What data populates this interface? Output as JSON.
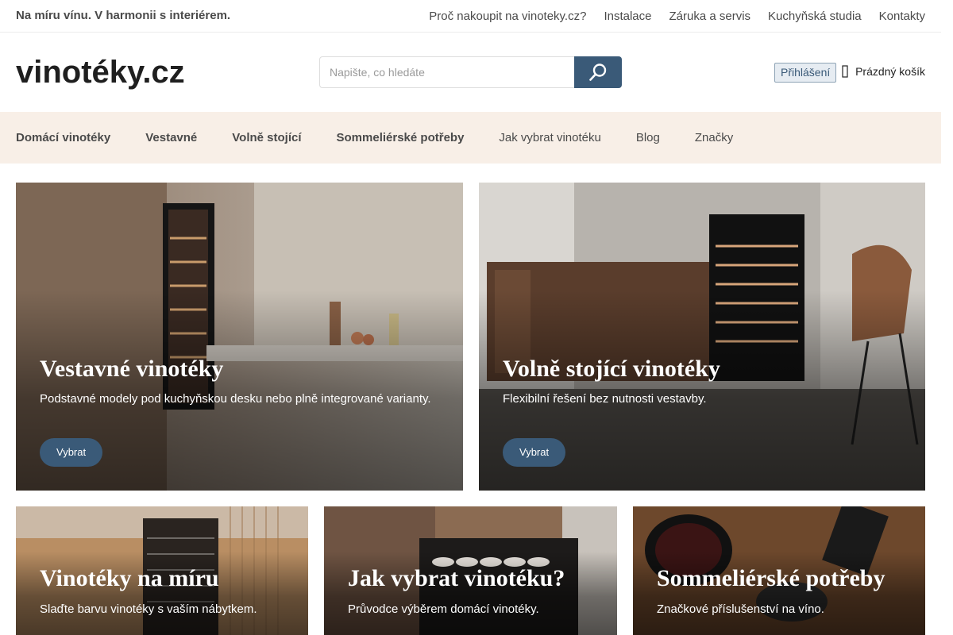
{
  "topbar": {
    "tagline": "Na míru vínu. V harmonii s interiérem.",
    "links": [
      "Proč nakoupit na vinoteky.cz?",
      "Instalace",
      "Záruka a servis",
      "Kuchyňská studia",
      "Kontakty"
    ]
  },
  "header": {
    "logo": {
      "text": "vinotéky.cz",
      "icon": "wine-bottle-logo-icon"
    },
    "search": {
      "placeholder": "Napište, co hledáte",
      "value": "",
      "icon": "search-icon"
    },
    "login_label": "Přihlášení",
    "cart": {
      "icon": "cart-icon",
      "label": "Prázdný košík"
    }
  },
  "nav": {
    "items": [
      {
        "label": "Domácí vinotéky",
        "bold": true
      },
      {
        "label": "Vestavné",
        "bold": true
      },
      {
        "label": "Volně stojící",
        "bold": true
      },
      {
        "label": "Sommeliérské potřeby",
        "bold": true
      },
      {
        "label": "Jak vybrat vinotéku",
        "bold": false
      },
      {
        "label": "Blog",
        "bold": false
      },
      {
        "label": "Značky",
        "bold": false
      }
    ]
  },
  "cards": [
    {
      "title": "Vestavné vinotéky",
      "text": "Podstavné modely pod kuchyňskou desku nebo plně integrované varianty.",
      "button": "Vybrat"
    },
    {
      "title": "Volně stojící vinotéky",
      "text": "Flexibilní řešení bez nutnosti vestavby.",
      "button": "Vybrat"
    },
    {
      "title": "Vinotéky na míru",
      "text": "Slaďte barvu vinotéky s vaším nábytkem."
    },
    {
      "title": "Jak vybrat vinotéku?",
      "text": "Průvodce výběrem domácí vinotéky."
    },
    {
      "title": "Sommeliérské potřeby",
      "text": "Značkové příslušenství na víno."
    }
  ],
  "colors": {
    "accent": "#3a5a78",
    "nav_background": "#f8efe7",
    "text": "#4a4a4a"
  }
}
